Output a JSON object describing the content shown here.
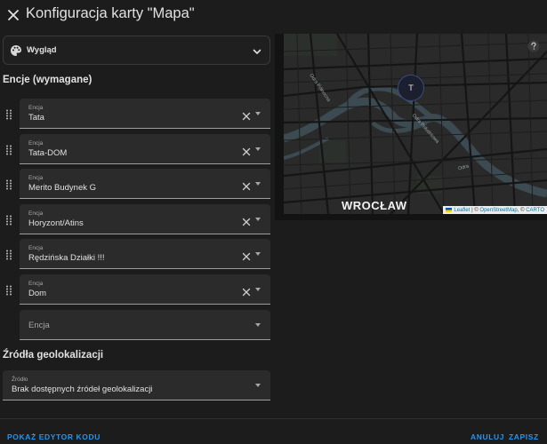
{
  "dialog": {
    "title": "Konfiguracja karty \"Mapa\""
  },
  "appearance": {
    "label": "Wygląd",
    "icon": "palette-icon"
  },
  "entities_section": {
    "title": "Encje (wymagane)",
    "field_label": "Encja",
    "items": [
      {
        "label": "Encja",
        "value": "Tata"
      },
      {
        "label": "Encja",
        "value": "Tata-DOM"
      },
      {
        "label": "Encja",
        "value": "Merito Budynek G"
      },
      {
        "label": "Encja",
        "value": "Horyzont/Atins"
      },
      {
        "label": "Encja",
        "value": "Rędzińska Działki !!!"
      },
      {
        "label": "Encja",
        "value": "Dom"
      }
    ],
    "new_entity_placeholder": "Encja"
  },
  "geo_section": {
    "title": "Źródła geolokalizacji",
    "field_label": "Źródło",
    "field_value": "Brak dostępnych źródeł geolokalizacji"
  },
  "map": {
    "city": "WROCŁAW",
    "marker_label": "T",
    "streets": [
      "Odra Północna",
      "Odra Południowa",
      "Odra"
    ],
    "attribution": {
      "leaflet": "Leaflet",
      "sep1": "|",
      "copy1": "©",
      "osm": "OpenStreetMap",
      "copy2": ", ©",
      "carto": "CARTO"
    }
  },
  "footer": {
    "show_code_editor": "POKAŻ EDYTOR KODU",
    "cancel": "ANULUJ",
    "save": "ZAPISZ"
  },
  "colors": {
    "background": "#1c1c1c",
    "accent": "#2196f3",
    "field_bg": "#2b2b2b"
  }
}
